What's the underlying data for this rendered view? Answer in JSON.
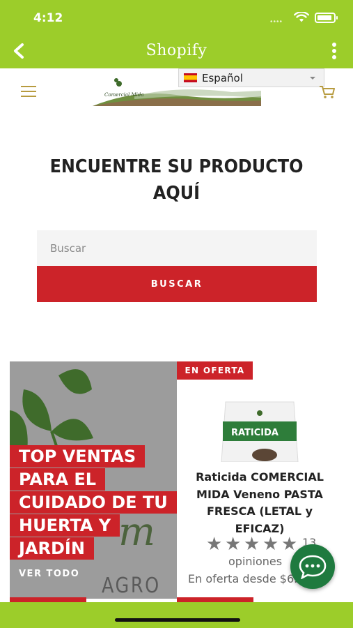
{
  "status_bar": {
    "time": "4:12"
  },
  "app_bar": {
    "title": "Shopify"
  },
  "site_header": {
    "language": "Español",
    "logo_text": "Comercial Mida"
  },
  "hero": {
    "title_line1": "ENCUENTRE SU PRODUCTO",
    "title_line2": "AQUÍ",
    "search_placeholder": "Buscar",
    "search_button": "BUSCAR"
  },
  "promo": {
    "lines": [
      "TOP VENTAS",
      "PARA EL",
      "CUIDADO DE TU",
      "HUERTA Y",
      "JARDÍN"
    ],
    "cta": "VER TODO",
    "watermark": "AGRO"
  },
  "product": {
    "badge": "EN OFERTA",
    "package_label": "RATICIDA",
    "title": "Raticida COMERCIAL MIDA Veneno PASTA FRESCA (LETAL y EFICAZ)",
    "rating": 5,
    "review_count": "13",
    "review_label": "opiniones",
    "price_text": "En oferta desde $6.5"
  },
  "colors": {
    "brand_green": "#9ccd2a",
    "accent_red": "#cc2329",
    "chat_green": "#1f7a3f"
  }
}
